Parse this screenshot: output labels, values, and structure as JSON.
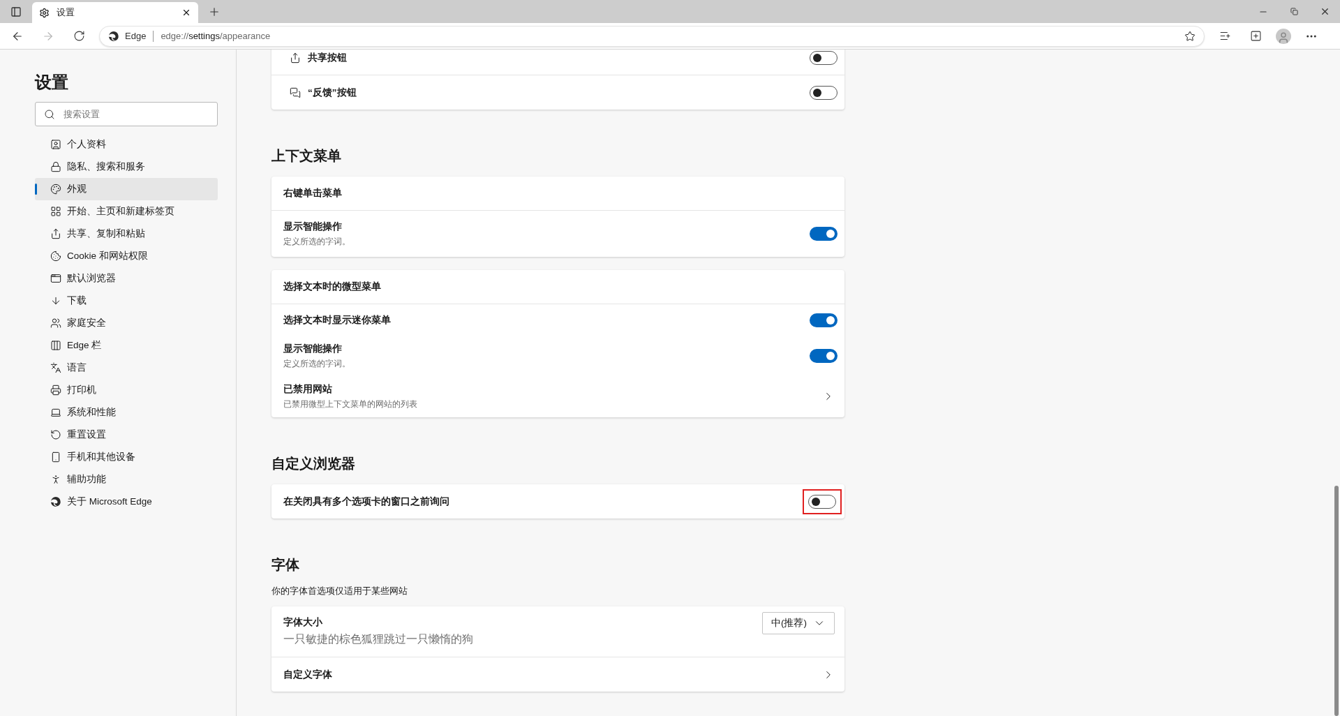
{
  "browser": {
    "tab": {
      "title": "设置"
    },
    "address": {
      "site": "Edge",
      "scheme": "edge://",
      "host": "settings",
      "path": "/appearance"
    }
  },
  "sidebar": {
    "title": "设置",
    "search": {
      "placeholder": "搜索设置"
    },
    "items": [
      {
        "label": "个人资料",
        "selected": false
      },
      {
        "label": "隐私、搜索和服务",
        "selected": false
      },
      {
        "label": "外观",
        "selected": true
      },
      {
        "label": "开始、主页和新建标签页",
        "selected": false
      },
      {
        "label": "共享、复制和粘贴",
        "selected": false
      },
      {
        "label": "Cookie 和网站权限",
        "selected": false
      },
      {
        "label": "默认浏览器",
        "selected": false
      },
      {
        "label": "下载",
        "selected": false
      },
      {
        "label": "家庭安全",
        "selected": false
      },
      {
        "label": "Edge 栏",
        "selected": false
      },
      {
        "label": "语言",
        "selected": false
      },
      {
        "label": "打印机",
        "selected": false
      },
      {
        "label": "系统和性能",
        "selected": false
      },
      {
        "label": "重置设置",
        "selected": false
      },
      {
        "label": "手机和其他设备",
        "selected": false
      },
      {
        "label": "辅助功能",
        "selected": false
      },
      {
        "label": "关于 Microsoft Edge",
        "selected": false
      }
    ]
  },
  "sections": [
    {
      "cards": [
        {
          "rows": [
            {
              "kind": "toggle",
              "label": "共享按钮",
              "on": false,
              "highlighted": false
            },
            {
              "kind": "toggle",
              "label": "“反馈”按钮",
              "on": false,
              "highlighted": false
            }
          ]
        }
      ]
    },
    {
      "heading": "上下文菜单",
      "cards": [
        {
          "rows": [
            {
              "kind": "header",
              "label": "右键单击菜单"
            },
            {
              "kind": "toggle",
              "label": "显示智能操作",
              "description": "定义所选的字词。",
              "on": true,
              "highlighted": false
            }
          ]
        },
        {
          "rows": [
            {
              "kind": "header",
              "label": "选择文本时的微型菜单"
            },
            {
              "kind": "toggle",
              "label": "选择文本时显示迷你菜单",
              "on": true,
              "highlighted": false
            },
            {
              "kind": "toggle",
              "label": "显示智能操作",
              "description": "定义所选的字词。",
              "on": true,
              "highlighted": false
            },
            {
              "kind": "link",
              "label": "已禁用网站",
              "description": "已禁用微型上下文菜单的网站的列表"
            }
          ]
        }
      ]
    },
    {
      "heading": "自定义浏览器",
      "cards": [
        {
          "rows": [
            {
              "kind": "toggle",
              "label": "在关闭具有多个选项卡的窗口之前询问",
              "on": false,
              "highlighted": true
            }
          ]
        }
      ]
    },
    {
      "heading": "字体",
      "description": "你的字体首选项仅适用于某些网站",
      "cards": [
        {
          "rows": [
            {
              "kind": "select",
              "label": "字体大小",
              "preview": "一只敏捷的棕色狐狸跳过一只懒惰的狗",
              "value": "中(推荐)"
            },
            {
              "kind": "link",
              "label": "自定义字体"
            }
          ]
        }
      ]
    }
  ]
}
